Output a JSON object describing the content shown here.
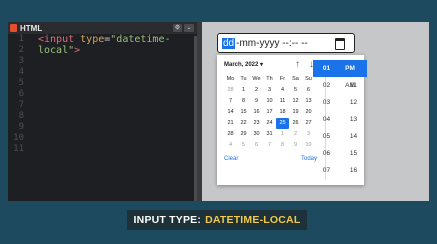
{
  "editor": {
    "tab_label": "HTML",
    "line_numbers": [
      "1",
      "2",
      "3",
      "4",
      "5",
      "6",
      "7",
      "8",
      "9",
      "10",
      "11"
    ],
    "code": {
      "tag_open": "<input",
      "attr": "type",
      "eq": "=",
      "value_line1": "\"datetime-",
      "value_line2": "local\"",
      "tag_close": ">"
    }
  },
  "preview": {
    "input": {
      "dd": "dd",
      "rest": "-mm-yyyy --:-- --"
    },
    "calendar": {
      "month_label": "March, 2022 ▾",
      "up_icon": "arrow-up-icon",
      "down_icon": "arrow-down-icon",
      "weekdays": [
        "Mo",
        "Tu",
        "We",
        "Th",
        "Fr",
        "Sa",
        "Su"
      ],
      "weeks": [
        [
          "28",
          "1",
          "2",
          "3",
          "4",
          "5",
          "6"
        ],
        [
          "7",
          "8",
          "9",
          "10",
          "11",
          "12",
          "13"
        ],
        [
          "14",
          "15",
          "16",
          "17",
          "18",
          "19",
          "20"
        ],
        [
          "21",
          "22",
          "23",
          "24",
          "25",
          "26",
          "27"
        ],
        [
          "28",
          "29",
          "30",
          "31",
          "1",
          "2",
          "3"
        ],
        [
          "4",
          "5",
          "6",
          "7",
          "8",
          "9",
          "10"
        ]
      ],
      "selected_day": "25",
      "clear_label": "Clear",
      "today_label": "Today"
    },
    "time": {
      "hours": [
        "01",
        "02",
        "03",
        "04",
        "05",
        "06",
        "07"
      ],
      "minutes": [
        "10",
        "11",
        "12",
        "13",
        "14",
        "15",
        "16"
      ],
      "ampm": [
        "PM",
        "AM"
      ]
    }
  },
  "caption": {
    "prefix": "INPUT TYPE:",
    "highlight": "DATETIME-LOCAL"
  },
  "colors": {
    "background": "#1d4a5e",
    "accent": "#1a73e8",
    "highlight": "#f0c94d"
  }
}
